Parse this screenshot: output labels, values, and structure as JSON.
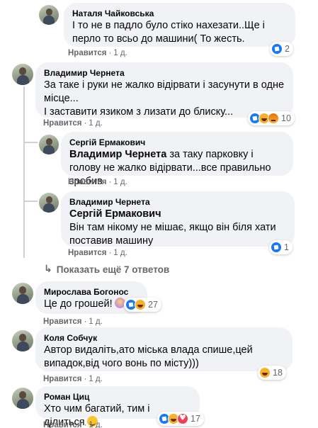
{
  "comments": [
    {
      "author": "Наталя Чайковська",
      "text": "І то не в падло було стіко нахезати..Ще і перло то всьо до машини( То жесть.",
      "like_label": "Нравится",
      "time": "1 д.",
      "reaction_count": "2"
    },
    {
      "author": "Владимир Чернета",
      "text": "За таке і руки не жалко відірвати і засунути в одне місце...\nІ заставити язиком з лизати до блиску...",
      "like_label": "Нравится",
      "time": "1 д.",
      "reaction_count": "10"
    },
    {
      "author": "Сергій Ермакович",
      "mention": "Владимир Чернета",
      "text": " за таку парковку і голову не жалко відірвати...все правильно зробив",
      "like_label": "Нравится",
      "time": "1 д."
    },
    {
      "author": "Владимир Чернета",
      "mention": "Сергій Ермакович",
      "text": "Він там нікому не мішає, якщо він біля хати поставив машину",
      "like_label": "Нравится",
      "time": "1 д.",
      "reaction_count": "1"
    },
    {
      "author": "Мирослава Богонос",
      "text": "Це до грошей!",
      "like_label": "Нравится",
      "time": "1 д.",
      "reaction_count": "27"
    },
    {
      "author": "Коля Собчук",
      "text": "Автор видаліть,ато міська влада спише,цей випадок,від чого вонь по місту)))",
      "like_label": "Нравится",
      "time": "1 д.",
      "reaction_count": "18"
    },
    {
      "author": "Роман Циц",
      "text": "Хто чим багатий, тим і ділиться",
      "like_label": "Нравится",
      "time": "1 д.",
      "reaction_count": "17"
    }
  ],
  "more_replies_label": "Показать ещё 7 ответов",
  "colors": {
    "bubble": "#f0f2f5",
    "meta_text": "#65676b",
    "like_blue": "#1877f2",
    "haha_yellow": "#f7b125",
    "love_red": "#f33e58"
  }
}
